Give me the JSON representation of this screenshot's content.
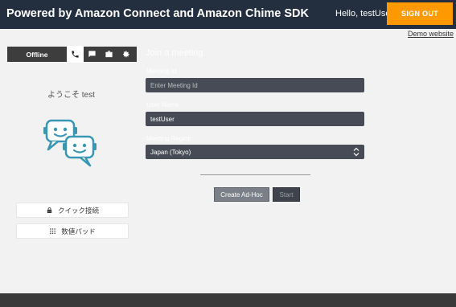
{
  "header": {
    "title": "Powered by Amazon Connect and Amazon Chime SDK",
    "greeting": "Hello, testUser",
    "sign_out_label": "SIGN OUT",
    "background_color": "#232f3e",
    "accent_color": "#ff9900"
  },
  "demo_link": "Demo website",
  "ccp": {
    "status": "Offline",
    "tabs": [
      "phone-icon",
      "chat-icon",
      "briefcase-icon",
      "gear-icon"
    ],
    "active_tab": "phone-icon"
  },
  "sidebar": {
    "welcome": "ようこそ test",
    "quick_connect_label": "クイック接続",
    "numpad_label": "数値パッド"
  },
  "meeting": {
    "title": "Join a meeting",
    "meeting_id_label": "Meeting Id",
    "meeting_id_placeholder": "Enter Meeting Id",
    "user_name_label": "User Name",
    "user_name_value": "testUser",
    "region_label": "Meeting Region",
    "region_value": "Japan (Tokyo)",
    "create_adhoc_label": "Create Ad-Hoc",
    "start_label": "Start"
  }
}
